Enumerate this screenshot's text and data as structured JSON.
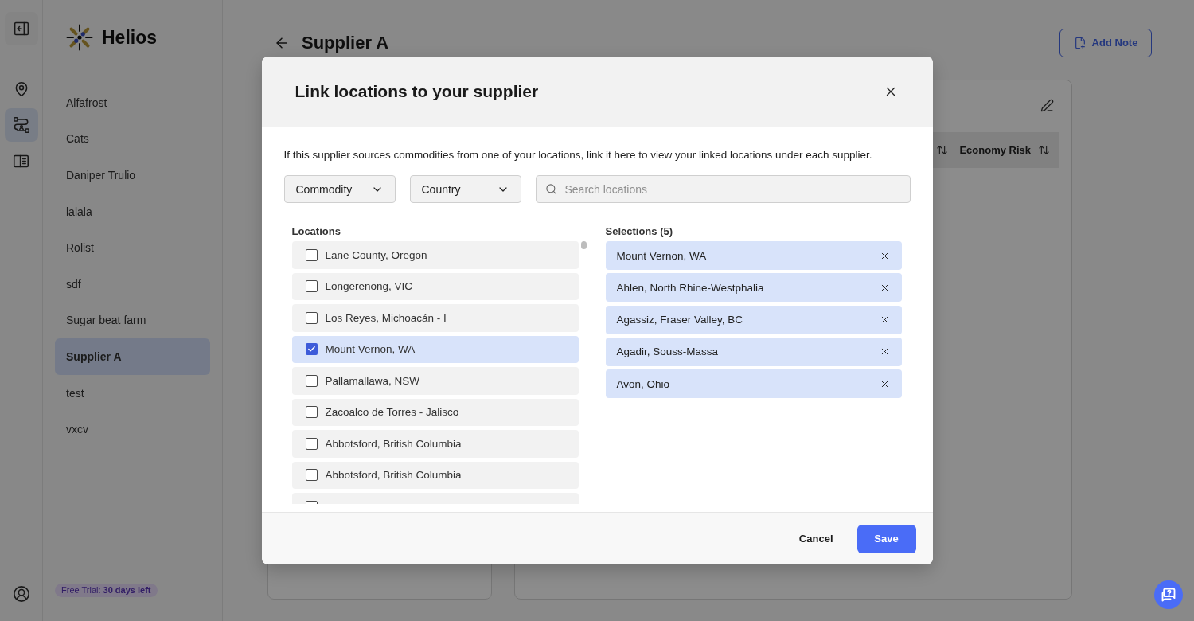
{
  "rail": {
    "items": [
      {
        "selected": false
      },
      {
        "selected": true
      },
      {
        "selected": false
      }
    ]
  },
  "sidebar": {
    "brand": "Helios",
    "items": [
      {
        "label": "Alfafrost",
        "selected": false
      },
      {
        "label": "Cats",
        "selected": false
      },
      {
        "label": "Daniper Trulio",
        "selected": false
      },
      {
        "label": "lalala",
        "selected": false
      },
      {
        "label": "Rolist",
        "selected": false
      },
      {
        "label": "sdf",
        "selected": false
      },
      {
        "label": "Sugar beat farm",
        "selected": false
      },
      {
        "label": "Supplier A",
        "selected": true
      },
      {
        "label": "test",
        "selected": false
      },
      {
        "label": "vxcv",
        "selected": false
      }
    ],
    "trial_badge": "Free Trial: **30 days left**"
  },
  "page": {
    "title": "Supplier A",
    "add_note_button": "Add Note",
    "table": {
      "columns": [
        {
          "sortable": true
        },
        {
          "label": "Economy Risk",
          "sortable": true
        }
      ]
    }
  },
  "modal": {
    "title": "Link locations to your supplier",
    "description": "If this supplier sources commodities from one of your locations, link it here to view your linked locations under each supplier.",
    "filters": [
      {
        "label": "Commodity"
      },
      {
        "label": "Country"
      }
    ],
    "search": {
      "placeholder": "Search locations"
    },
    "locations": {
      "heading": "Locations",
      "items": [
        {
          "label": "Lane County, Oregon",
          "checked": false
        },
        {
          "label": "Longerenong, VIC",
          "checked": false
        },
        {
          "label": "Los Reyes, Michoacán - I",
          "checked": false
        },
        {
          "label": "Mount Vernon, WA",
          "checked": true
        },
        {
          "label": "Pallamallawa, NSW",
          "checked": false
        },
        {
          "label": "Zacoalco de Torres - Jalisco",
          "checked": false
        },
        {
          "label": "Abbotsford, British Columbia",
          "checked": false
        },
        {
          "label": "Abbotsford, British Columbia",
          "checked": false
        },
        {
          "checked": false
        }
      ]
    },
    "selections": {
      "heading": "Selections (5)",
      "items": [
        "Mount Vernon, WA",
        "Ahlen, North Rhine-Westphalia",
        "Agassiz, Fraser Valley, BC",
        "Agadir, Souss-Massa",
        "Avon, Ohio"
      ]
    },
    "buttons": {
      "cancel": "Cancel",
      "save": "Save"
    }
  }
}
